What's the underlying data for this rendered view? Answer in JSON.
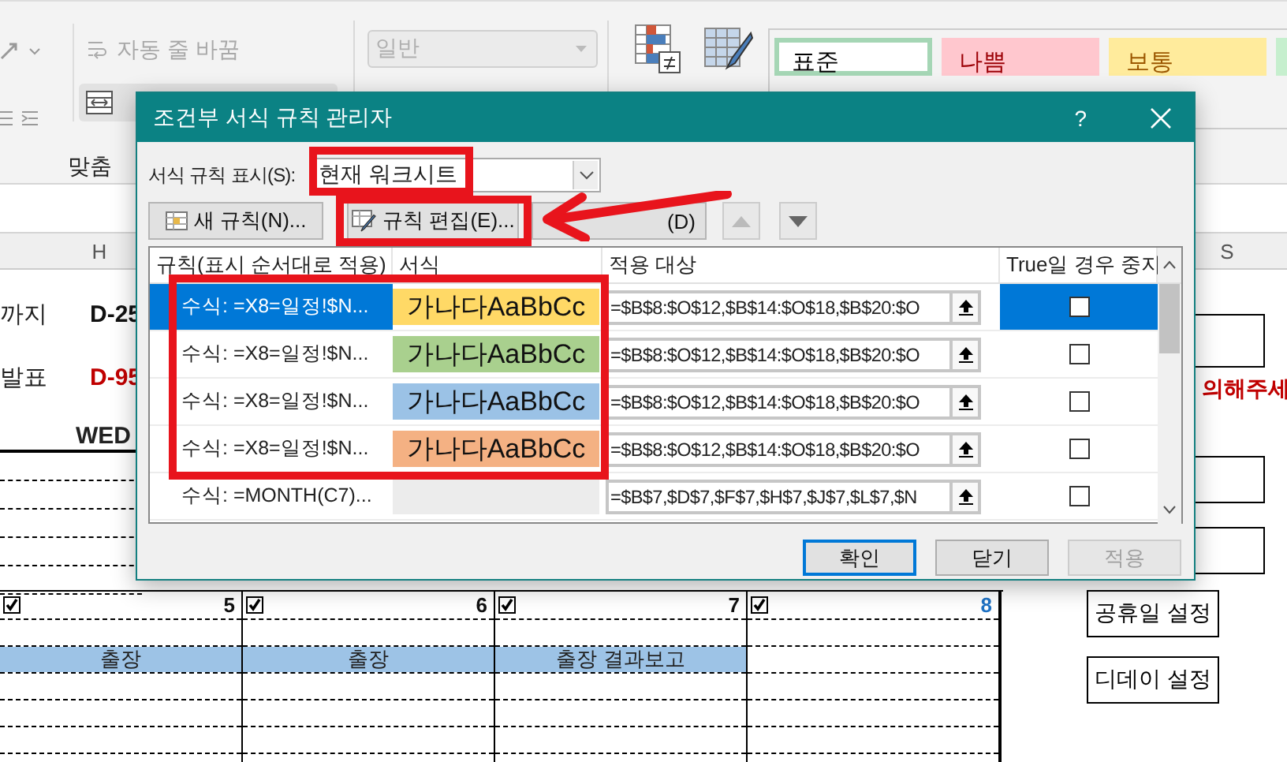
{
  "ribbon": {
    "wrap_text": {
      "label": "자동 줄 바꿈",
      "disabled": true
    },
    "group_label": "맞춤",
    "number_format": {
      "value": "일반",
      "disabled": true
    },
    "styles": [
      {
        "label": "표준",
        "selected": true,
        "kind": "normal"
      },
      {
        "label": "나쁨",
        "selected": false,
        "kind": "bad"
      },
      {
        "label": "보통",
        "selected": false,
        "kind": "neutral"
      }
    ]
  },
  "sheet": {
    "columns": [
      "H",
      "S"
    ],
    "dday_rows": [
      {
        "label": "까지",
        "dday": "D-25",
        "kind": "normal"
      },
      {
        "label": "발표",
        "dday": "D-95",
        "kind": "urgent"
      }
    ],
    "weekday": "WED",
    "notice": "의해주세",
    "side_buttons": [
      "공휴일 설정",
      "디데이 설정"
    ],
    "week": [
      {
        "number": "5",
        "checked": true,
        "kind": "weekday",
        "event": "출장"
      },
      {
        "number": "6",
        "checked": true,
        "kind": "weekday",
        "event": "출장"
      },
      {
        "number": "7",
        "checked": true,
        "kind": "weekday",
        "event": "출장 결과보고"
      },
      {
        "number": "8",
        "checked": true,
        "kind": "saturday"
      }
    ]
  },
  "dialog": {
    "title": "조건부 서식 규칙 관리자",
    "help": "?",
    "show_label": "서식 규칙 표시(S):",
    "show_value": "현재 워크시트",
    "buttons": [
      {
        "label": "새 규칙(N)...",
        "kind": "new"
      },
      {
        "label": "규칙 편집(E)...",
        "kind": "edit"
      },
      {
        "label": "(D)",
        "kind": "delete"
      }
    ],
    "columns": [
      "규칙(표시 순서대로 적용)",
      "서식",
      "적용 대상",
      "True일 경우 중지"
    ],
    "rules": [
      {
        "rule": "수식: =X8=일정!$N...",
        "preview": "가나다AaBbCc",
        "color": "#ffd966",
        "applies_to": "=$B$8:$O$12,$B$14:$O$18,$B$20:$O",
        "stop": false,
        "selected": true
      },
      {
        "rule": "수식: =X8=일정!$N...",
        "preview": "가나다AaBbCc",
        "color": "#a9d08e",
        "applies_to": "=$B$8:$O$12,$B$14:$O$18,$B$20:$O",
        "stop": false,
        "selected": false
      },
      {
        "rule": "수식: =X8=일정!$N...",
        "preview": "가나다AaBbCc",
        "color": "#9bc2e6",
        "applies_to": "=$B$8:$O$12,$B$14:$O$18,$B$20:$O",
        "stop": false,
        "selected": false
      },
      {
        "rule": "수식: =X8=일정!$N...",
        "preview": "가나다AaBbCc",
        "color": "#f4b183",
        "applies_to": "=$B$8:$O$12,$B$14:$O$18,$B$20:$O",
        "stop": false,
        "selected": false
      },
      {
        "rule": "수식: =MONTH(C7)...",
        "applies_to": "=$B$7,$D$7,$F$7,$H$7,$J$7,$L$7,$N",
        "stop": false,
        "selected": false
      }
    ],
    "footer": [
      {
        "label": "확인",
        "kind": "default"
      },
      {
        "label": "닫기",
        "kind": "normal"
      },
      {
        "label": "적용",
        "kind": "disabled"
      }
    ]
  },
  "annotations": [
    {
      "kind": "box"
    },
    {
      "kind": "box"
    },
    {
      "kind": "box"
    },
    {
      "kind": "arrow"
    }
  ]
}
